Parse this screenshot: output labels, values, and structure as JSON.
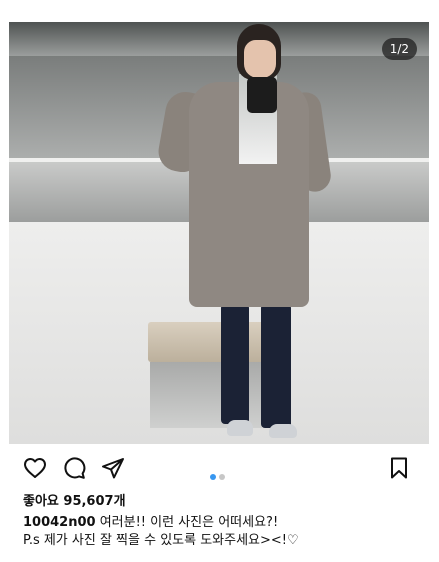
{
  "post": {
    "page_indicator": "1/2",
    "carousel": {
      "current": 1,
      "total": 2
    },
    "likes_text": "좋아요 95,607개",
    "username": "10042n00",
    "caption_line1": "여러분!! 이런 사진은 어떠세요?!",
    "caption_line2": "P.s 제가 사진 잘 찍을 수 있도록 도와주세요><!♡"
  },
  "colors": {
    "indicator_active": "#3897f0",
    "indicator_inactive": "#c7c7c7"
  },
  "icons": [
    "heart-icon",
    "comment-icon",
    "share-icon",
    "bookmark-icon"
  ]
}
